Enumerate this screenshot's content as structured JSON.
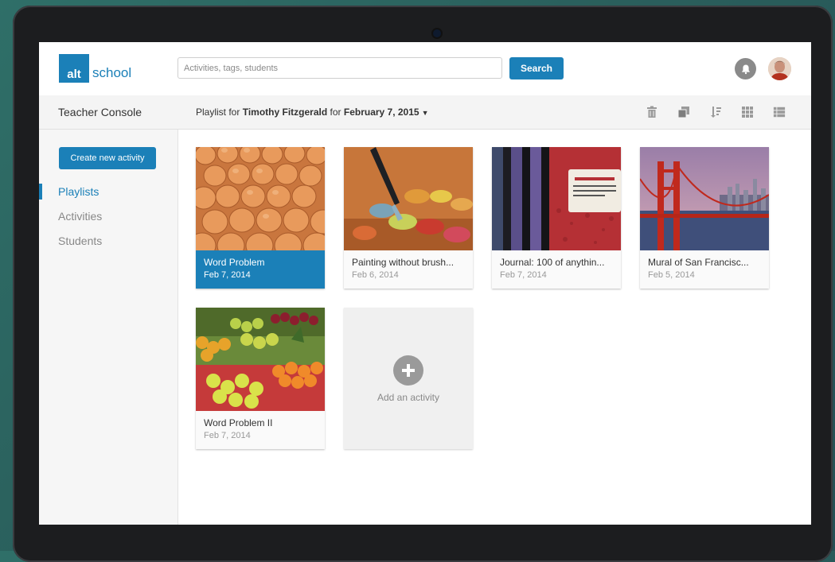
{
  "header": {
    "logo": {
      "mark": "alt",
      "text": "school"
    },
    "search": {
      "placeholder": "Activities, tags, students",
      "button_label": "Search"
    },
    "icons": [
      "bell-icon",
      "user-avatar"
    ]
  },
  "subheader": {
    "title": "Teacher Console",
    "playlist_prefix": "Playlist for",
    "student_name": "Timothy Fitzgerald",
    "for_word": "for",
    "date": "February 7, 2015",
    "tools": [
      "trash-icon",
      "duplicate-icon",
      "sort-icon",
      "grid-view-icon",
      "list-view-icon"
    ]
  },
  "sidebar": {
    "create_button": "Create new activity",
    "items": [
      {
        "label": "Playlists",
        "active": true
      },
      {
        "label": "Activities",
        "active": false
      },
      {
        "label": "Students",
        "active": false
      }
    ]
  },
  "cards": [
    {
      "title": "Word Problem",
      "date": "Feb 7, 2014",
      "selected": true,
      "image": "eggs-in-carton"
    },
    {
      "title": "Painting without brush...",
      "date": "Feb 6, 2014",
      "selected": false,
      "image": "paint-palette"
    },
    {
      "title": "Journal: 100 of anythin...",
      "date": "Feb 7, 2014",
      "selected": false,
      "image": "composition-notebooks"
    },
    {
      "title": "Mural of San Francisc...",
      "date": "Feb 5, 2014",
      "selected": false,
      "image": "golden-gate-bridge"
    },
    {
      "title": "Word Problem II",
      "date": "Feb 7, 2014",
      "selected": false,
      "image": "fruit-market"
    }
  ],
  "add_activity": {
    "label": "Add an activity"
  },
  "colors": {
    "accent": "#1b80b8",
    "sidebar_bg": "#f6f6f6",
    "subbar_bg": "#f4f4f4"
  }
}
